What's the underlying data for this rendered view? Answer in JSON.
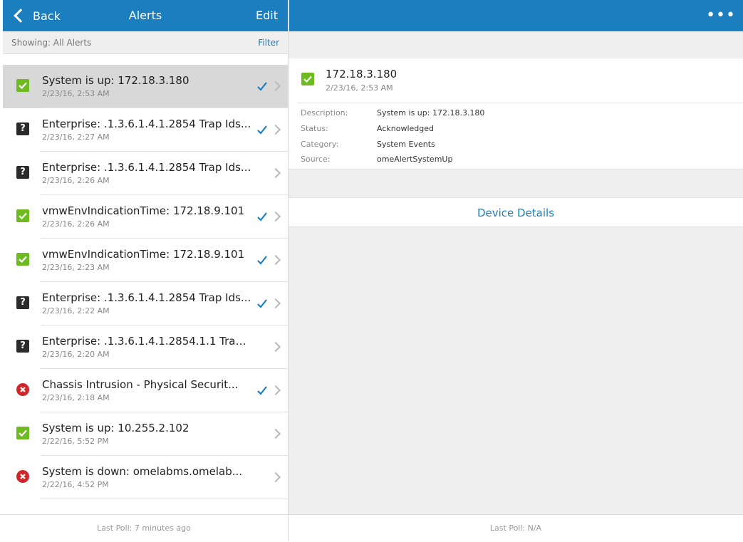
{
  "left_nav": {
    "back_label": "Back",
    "title": "Alerts",
    "edit_label": "Edit"
  },
  "right_nav": {
    "more_label": "•••"
  },
  "filter_bar": {
    "showing_text": "Showing: All Alerts",
    "filter_label": "Filter"
  },
  "alerts": [
    {
      "title": "System is up: 172.18.3.180",
      "time": "2/23/16, 2:53 AM",
      "severity": "ok-icon",
      "acknowledged": true,
      "selected": true
    },
    {
      "title": "Enterprise: .1.3.6.1.4.1.2854 Trap Ids...",
      "time": "2/23/16, 2:27 AM",
      "severity": "unknown-icon",
      "acknowledged": true,
      "selected": false
    },
    {
      "title": "Enterprise: .1.3.6.1.4.1.2854 Trap Ids...",
      "time": "2/23/16, 2:26 AM",
      "severity": "unknown-icon",
      "acknowledged": false,
      "selected": false
    },
    {
      "title": "vmwEnvIndicationTime: 172.18.9.101",
      "time": "2/23/16, 2:26 AM",
      "severity": "ok-icon",
      "acknowledged": true,
      "selected": false
    },
    {
      "title": "vmwEnvIndicationTime: 172.18.9.101",
      "time": "2/23/16, 2:23 AM",
      "severity": "ok-icon",
      "acknowledged": true,
      "selected": false
    },
    {
      "title": "Enterprise: .1.3.6.1.4.1.2854 Trap Ids...",
      "time": "2/23/16, 2:22 AM",
      "severity": "unknown-icon",
      "acknowledged": true,
      "selected": false
    },
    {
      "title": "Enterprise: .1.3.6.1.4.1.2854.1.1 Trap...",
      "time": "2/23/16, 2:20 AM",
      "severity": "unknown-icon",
      "acknowledged": false,
      "selected": false
    },
    {
      "title": "Chassis Intrusion - Physical Securit...",
      "time": "2/23/16, 2:18 AM",
      "severity": "critical-icon",
      "acknowledged": true,
      "selected": false
    },
    {
      "title": "System is up: 10.255.2.102",
      "time": "2/22/16, 5:52 PM",
      "severity": "ok-icon",
      "acknowledged": false,
      "selected": false
    },
    {
      "title": "System is down: omelabms.omelab...",
      "time": "2/22/16, 4:52 PM",
      "severity": "critical-icon",
      "acknowledged": false,
      "selected": false
    }
  ],
  "left_footer": {
    "text": "Last Poll: 7 minutes ago"
  },
  "detail": {
    "title": "172.18.3.180",
    "time": "2/23/16, 2:53 AM",
    "severity": "ok-icon",
    "fields": [
      {
        "label": "Description:",
        "value": "System is up: 172.18.3.180"
      },
      {
        "label": "Status:",
        "value": "Acknowledged"
      },
      {
        "label": "Category:",
        "value": "System Events"
      },
      {
        "label": "Source:",
        "value": "omeAlertSystemUp"
      }
    ],
    "device_details_label": "Device Details"
  },
  "right_footer": {
    "text": "Last Poll: N/A"
  },
  "colors": {
    "accent": "#1b7ebf",
    "ok": "#6dbb1f",
    "critical": "#d0262a",
    "unknown": "#2b2b2b"
  }
}
